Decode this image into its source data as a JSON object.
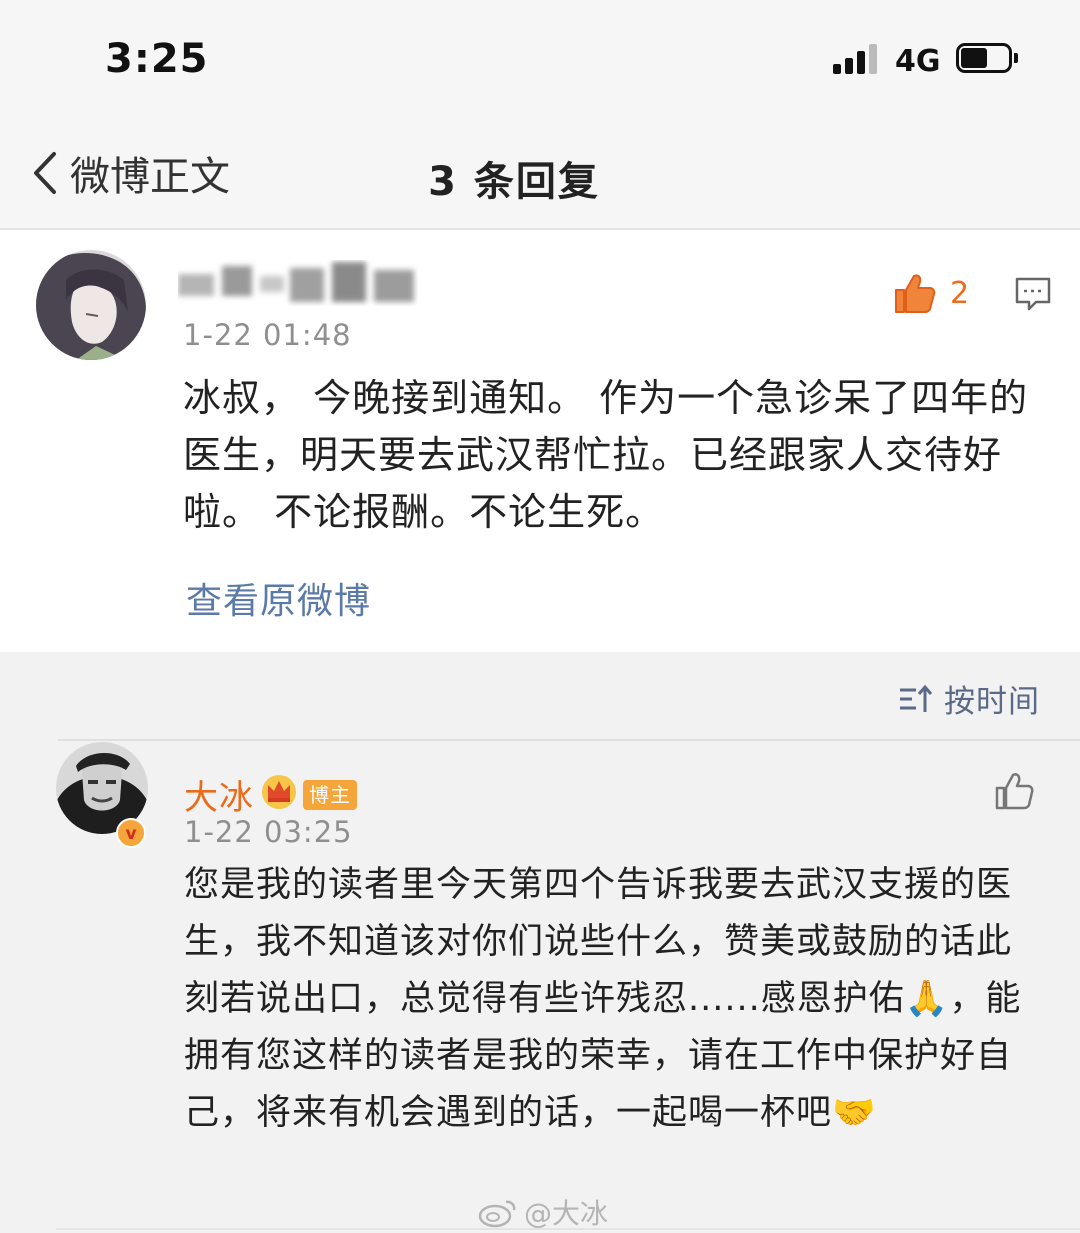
{
  "status_bar": {
    "time": "3:25",
    "network": "4G"
  },
  "nav": {
    "back_label": "微博正文",
    "title": "3 条回复"
  },
  "original_comment": {
    "timestamp": "1-22 01:48",
    "like_count": "2",
    "text": "冰叔， 今晚接到通知。 作为一个急诊呆了四年的医生，明天要去武汉帮忙拉。已经跟家人交待好啦。 不论报酬。不论生死。",
    "view_original_label": "查看原微博",
    "colors": {
      "like": "#f06b20",
      "link": "#5b7aa8"
    }
  },
  "sort": {
    "label": "按时间"
  },
  "reply": {
    "author": "大冰",
    "badge": "博主",
    "timestamp": "1-22 03:25",
    "text": "您是我的读者里今天第四个告诉我要去武汉支援的医生，我不知道该对你们说些什么，赞美或鼓励的话此刻若说出口，总觉得有些许残忍......感恩护佑🙏，能拥有您这样的读者是我的荣幸，请在工作中保护好自己，将来有机会遇到的话，一起喝一杯吧🤝",
    "colors": {
      "author": "#ea6c1a",
      "badge": "#f5a53a"
    }
  },
  "watermark": {
    "text": "@大冰"
  }
}
